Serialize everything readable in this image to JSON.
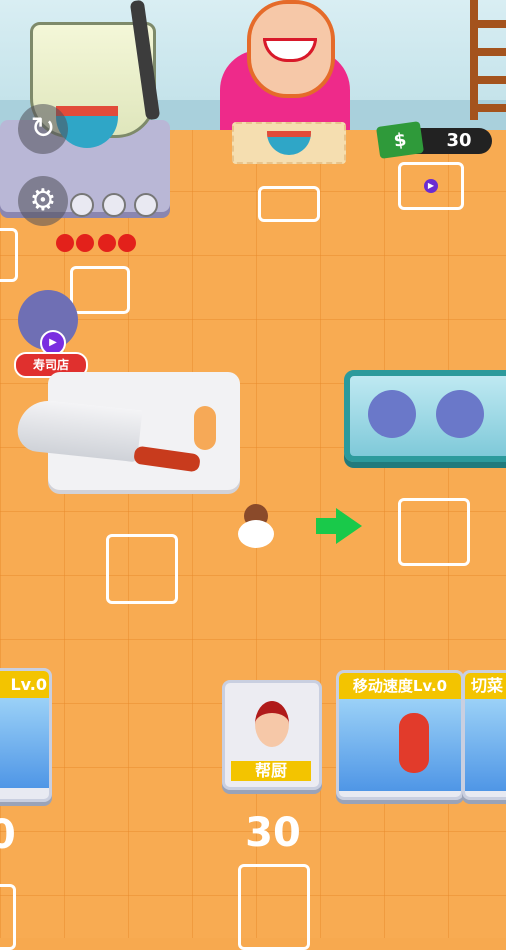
{
  "hud": {
    "cash_amount": "30",
    "cash_icon": "cash-icon",
    "restart_icon": "restart-icon",
    "settings_icon": "gear-icon"
  },
  "sushi_shop": {
    "label": "寿司店",
    "icon": "sushi-icon",
    "play_icon": "play-icon"
  },
  "order": {
    "item_icon": "tomato-soup-icon"
  },
  "cards": {
    "left_partial_label": "Lv.0",
    "helper_label": "帮厨",
    "move_speed_label": "移动速度Lv.0",
    "right_partial_label": "切菜"
  },
  "bottom": {
    "left_partial_number": "0",
    "center_number": "30"
  },
  "colors": {
    "floor": "#f8ab52",
    "card_label_bg": "#f3c400",
    "shop_badge": "#e0302e",
    "arrow": "#19c94a"
  }
}
